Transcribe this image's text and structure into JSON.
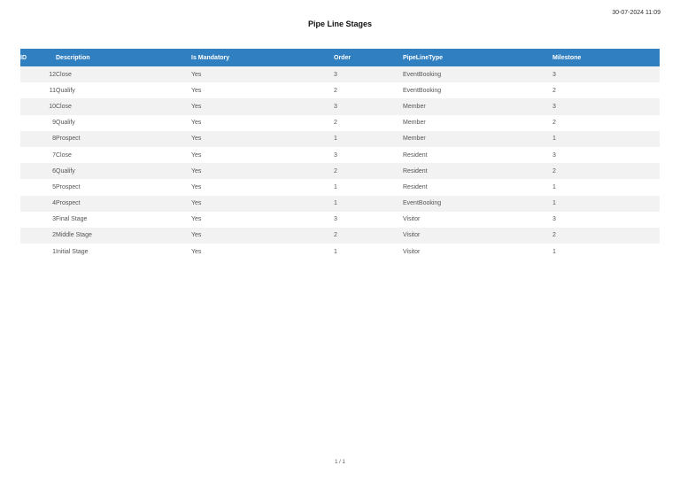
{
  "report": {
    "timestamp": "30-07-2024 11:09",
    "title": "Pipe Line Stages",
    "page_indicator": "1 / 1"
  },
  "table": {
    "columns": [
      "ID",
      "Description",
      "Is Mandatory",
      "Order",
      "PipeLineType",
      "Milestone"
    ],
    "rows": [
      [
        "12",
        "Close",
        "Yes",
        "3",
        "EventBooking",
        "3"
      ],
      [
        "11",
        "Qualify",
        "Yes",
        "2",
        "EventBooking",
        "2"
      ],
      [
        "10",
        "Close",
        "Yes",
        "3",
        "Member",
        "3"
      ],
      [
        "9",
        "Qualify",
        "Yes",
        "2",
        "Member",
        "2"
      ],
      [
        "8",
        "Prospect",
        "Yes",
        "1",
        "Member",
        "1"
      ],
      [
        "7",
        "Close",
        "Yes",
        "3",
        "Resident",
        "3"
      ],
      [
        "6",
        "Qualify",
        "Yes",
        "2",
        "Resident",
        "2"
      ],
      [
        "5",
        "Prospect",
        "Yes",
        "1",
        "Resident",
        "1"
      ],
      [
        "4",
        "Prospect",
        "Yes",
        "1",
        "EventBooking",
        "1"
      ],
      [
        "3",
        "Final Stage",
        "Yes",
        "3",
        "Visitor",
        "3"
      ],
      [
        "2",
        "Middle Stage",
        "Yes",
        "2",
        "Visitor",
        "2"
      ],
      [
        "1",
        "Initial Stage",
        "Yes",
        "1",
        "Visitor",
        "1"
      ]
    ]
  },
  "colors": {
    "header_bg": "#2f7fc1",
    "header_text": "#ffffff",
    "stripe_row": "#f2f2f2"
  }
}
